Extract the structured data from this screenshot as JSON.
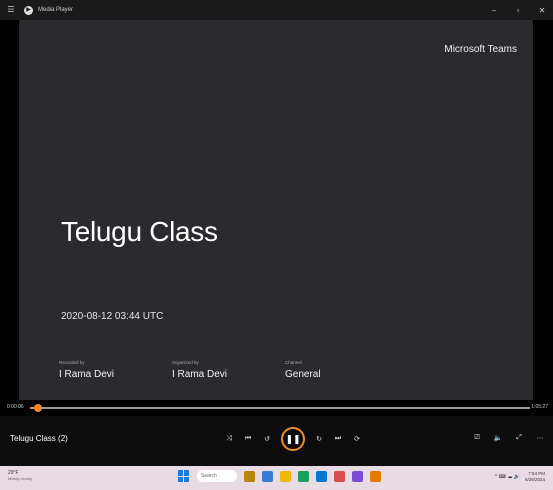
{
  "window": {
    "title": "Media Player",
    "menu_icon": "☰",
    "app_icon": "▶",
    "minimize_glyph": "–",
    "maximize_glyph": "▫",
    "close_glyph": "✕"
  },
  "video": {
    "brand": "Microsoft Teams",
    "title": "Telugu Class",
    "datetime": "2020-08-12 03:44 UTC",
    "meta": [
      {
        "label": "Recorded by",
        "value": "I Rama Devi"
      },
      {
        "label": "Organized by",
        "value": "I Rama Devi"
      },
      {
        "label": "Channel",
        "value": "General"
      }
    ]
  },
  "player": {
    "elapsed": "0:00:06",
    "duration": "1:05:27",
    "progress_fraction": 0.015,
    "media_title": "Telugu Class (2)",
    "accent_color": "#f08a2e",
    "buttons": {
      "shuffle": "⤨",
      "previous": "⏮",
      "rewind": "↺",
      "play_pause": "❚❚",
      "forward": "↻",
      "next": "⏭",
      "repeat": "⟳",
      "cast": "⎚",
      "volume": "🔈",
      "fullscreen": "⤢",
      "more": "⋯"
    }
  },
  "taskbar": {
    "weather_temp": "29°F",
    "weather_desc": "Mostly cloudy",
    "search_placeholder": "Search",
    "time": "7:54 PM",
    "date": "6/28/2024",
    "tray_glyphs": "^ ⌨ ☁ 🔊"
  }
}
